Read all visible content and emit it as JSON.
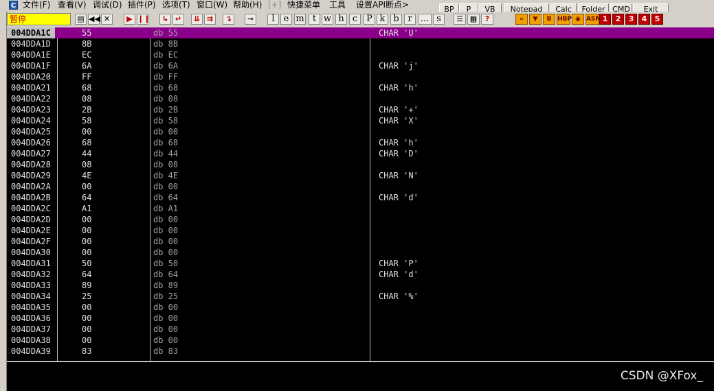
{
  "menu": [
    "文件(F)",
    "查看(V)",
    "调试(D)",
    "插件(P)",
    "选项(T)",
    "窗口(W)",
    "帮助(H)",
    "[+]",
    "快捷菜单",
    "工具",
    "设置API断点>"
  ],
  "app_icon_letter": "C",
  "command_buttons": [
    "BP",
    "P",
    "VB",
    "Notepad",
    "Calc",
    "Folder",
    "CMD",
    "Exit"
  ],
  "status": "暂停",
  "toolbar_letters": [
    "l",
    "e",
    "m",
    "t",
    "w",
    "h",
    "c",
    "P",
    "k",
    "b",
    "r",
    "...",
    "s"
  ],
  "plugin_labels": [
    "HBP",
    "ASM",
    "1",
    "2",
    "3",
    "4",
    "5"
  ],
  "rows": [
    {
      "addr": "004DDA1C",
      "hex": "55",
      "dis": "db 55",
      "cmt": "CHAR 'U'"
    },
    {
      "addr": "004DDA1D",
      "hex": "8B",
      "dis": "db 8B",
      "cmt": ""
    },
    {
      "addr": "004DDA1E",
      "hex": "EC",
      "dis": "db EC",
      "cmt": ""
    },
    {
      "addr": "004DDA1F",
      "hex": "6A",
      "dis": "db 6A",
      "cmt": "CHAR 'j'"
    },
    {
      "addr": "004DDA20",
      "hex": "FF",
      "dis": "db FF",
      "cmt": ""
    },
    {
      "addr": "004DDA21",
      "hex": "68",
      "dis": "db 68",
      "cmt": "CHAR 'h'"
    },
    {
      "addr": "004DDA22",
      "hex": "08",
      "dis": "db 08",
      "cmt": ""
    },
    {
      "addr": "004DDA23",
      "hex": "2B",
      "dis": "db 2B",
      "cmt": "CHAR '+'"
    },
    {
      "addr": "004DDA24",
      "hex": "58",
      "dis": "db 58",
      "cmt": "CHAR 'X'"
    },
    {
      "addr": "004DDA25",
      "hex": "00",
      "dis": "db 00",
      "cmt": ""
    },
    {
      "addr": "004DDA26",
      "hex": "68",
      "dis": "db 68",
      "cmt": "CHAR 'h'"
    },
    {
      "addr": "004DDA27",
      "hex": "44",
      "dis": "db 44",
      "cmt": "CHAR 'D'"
    },
    {
      "addr": "004DDA28",
      "hex": "08",
      "dis": "db 08",
      "cmt": ""
    },
    {
      "addr": "004DDA29",
      "hex": "4E",
      "dis": "db 4E",
      "cmt": "CHAR 'N'"
    },
    {
      "addr": "004DDA2A",
      "hex": "00",
      "dis": "db 00",
      "cmt": ""
    },
    {
      "addr": "004DDA2B",
      "hex": "64",
      "dis": "db 64",
      "cmt": "CHAR 'd'"
    },
    {
      "addr": "004DDA2C",
      "hex": "A1",
      "dis": "db A1",
      "cmt": ""
    },
    {
      "addr": "004DDA2D",
      "hex": "00",
      "dis": "db 00",
      "cmt": ""
    },
    {
      "addr": "004DDA2E",
      "hex": "00",
      "dis": "db 00",
      "cmt": ""
    },
    {
      "addr": "004DDA2F",
      "hex": "00",
      "dis": "db 00",
      "cmt": ""
    },
    {
      "addr": "004DDA30",
      "hex": "00",
      "dis": "db 00",
      "cmt": ""
    },
    {
      "addr": "004DDA31",
      "hex": "50",
      "dis": "db 50",
      "cmt": "CHAR 'P'"
    },
    {
      "addr": "004DDA32",
      "hex": "64",
      "dis": "db 64",
      "cmt": "CHAR 'd'"
    },
    {
      "addr": "004DDA33",
      "hex": "89",
      "dis": "db 89",
      "cmt": ""
    },
    {
      "addr": "004DDA34",
      "hex": "25",
      "dis": "db 25",
      "cmt": "CHAR '%'"
    },
    {
      "addr": "004DDA35",
      "hex": "00",
      "dis": "db 00",
      "cmt": ""
    },
    {
      "addr": "004DDA36",
      "hex": "00",
      "dis": "db 00",
      "cmt": ""
    },
    {
      "addr": "004DDA37",
      "hex": "00",
      "dis": "db 00",
      "cmt": ""
    },
    {
      "addr": "004DDA38",
      "hex": "00",
      "dis": "db 00",
      "cmt": ""
    },
    {
      "addr": "004DDA39",
      "hex": "83",
      "dis": "db 83",
      "cmt": ""
    }
  ],
  "watermark": "CSDN @XFox_",
  "colors": {
    "selected_row": "#8b008b",
    "status_bg": "#ffff00",
    "status_text": "#d00000"
  }
}
